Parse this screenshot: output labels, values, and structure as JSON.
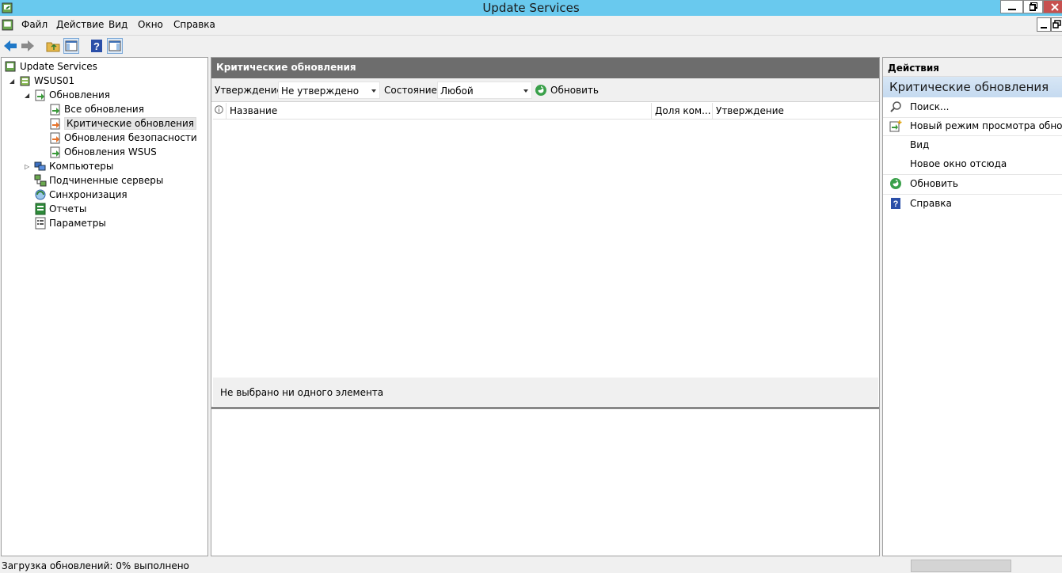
{
  "window": {
    "title": "Update Services",
    "controls": {
      "minimize": "minimize",
      "restore": "restore",
      "close": "close"
    }
  },
  "menu": {
    "items": [
      "Файл",
      "Действие",
      "Вид",
      "Окно",
      "Справка"
    ]
  },
  "toolbar": {
    "buttons": [
      "back-arrow-icon",
      "forward-arrow-icon",
      "folder-up-icon",
      "show-hide-console-tree-icon",
      "help-icon",
      "show-hide-action-pane-icon"
    ]
  },
  "tree": {
    "root": "Update Services",
    "server": "WSUS01",
    "updates": "Обновления",
    "updates_children": [
      "Все обновления",
      "Критические обновления",
      "Обновления безопасности",
      "Обновления WSUS"
    ],
    "computers": "Компьютеры",
    "downstream": "Подчиненные серверы",
    "sync": "Синхронизация",
    "reports": "Отчеты",
    "options": "Параметры",
    "selected": "Критические обновления"
  },
  "center": {
    "header": "Критические обновления",
    "filter": {
      "approval_label": "Утверждение:",
      "approval_value": "Не утверждено",
      "status_label": "Состояние:",
      "status_value": "Любой",
      "refresh_label": "Обновить"
    },
    "columns": [
      "Название",
      "Доля ком...",
      "Утверждение"
    ],
    "rows": [],
    "detail_text": "Не выбрано ни одного элемента"
  },
  "actions": {
    "header": "Действия",
    "section": "Критические обновления",
    "items": [
      "Поиск...",
      "Новый режим просмотра обнов...",
      "Вид",
      "Новое окно отсюда",
      "Обновить",
      "Справка"
    ]
  },
  "status": {
    "text": "Загрузка обновлений:  0% выполнено",
    "progress_percent": 0
  },
  "colors": {
    "titlebar": "#69c9ee",
    "pane_header": "#6d6d6d",
    "actions_section": "#c5daf0"
  }
}
